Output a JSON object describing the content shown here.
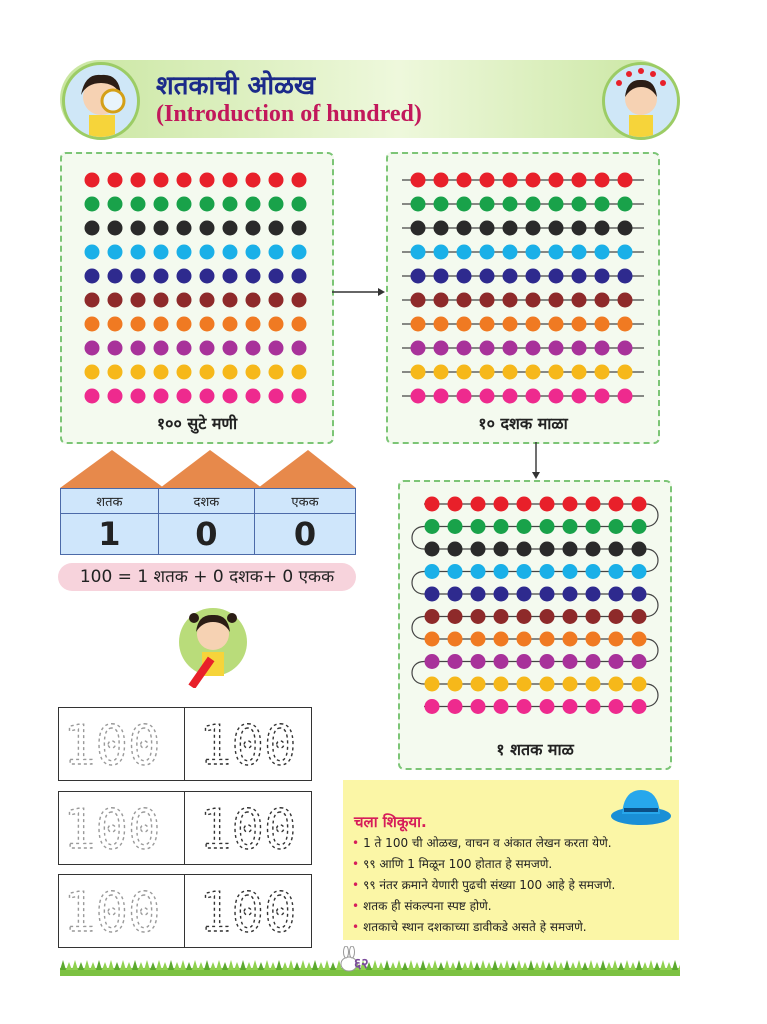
{
  "header": {
    "title_mr": "शतकाची ओळख",
    "title_en": "(Introduction of hundred)"
  },
  "panels": {
    "loose_beads_label": "१०० सुटे मणी",
    "tens_strings_label": "१० दशक माळा",
    "hundred_string_label": "१ शतक माळ"
  },
  "bead_colors": [
    "#e8202a",
    "#19a24a",
    "#2a2a2a",
    "#1ab0e8",
    "#2e2a8e",
    "#8e2a2a",
    "#f07a22",
    "#a8329a",
    "#f6b81a",
    "#ee2a8e"
  ],
  "place_value": {
    "headers": [
      "शतक",
      "दशक",
      "एकक"
    ],
    "values": [
      "1",
      "0",
      "0"
    ]
  },
  "equation": "100 = 1 शतक + 0 दशक+ 0 एकक",
  "practice": {
    "rows": [
      {
        "left": "100",
        "right": "100"
      },
      {
        "left": "100",
        "right": "100"
      },
      {
        "left": "100",
        "right": "100"
      }
    ]
  },
  "lesson": {
    "title": "चला शिकूया.",
    "items": [
      "1 ते 100 ची ओळख, वाचन व अंकात लेखन करता येणे.",
      "९९ आणि 1 मिळून 100 होतात हे समजणे.",
      "९९ नंतर क्रमाने येणारी पुढची संख्या 100 आहे हे समजणे.",
      "शतक ही संकल्पना स्पष्ट होणे.",
      "शतकाचे स्थान दशकाच्या डावीकडे असते हे समजणे."
    ]
  },
  "page_number": "६२"
}
